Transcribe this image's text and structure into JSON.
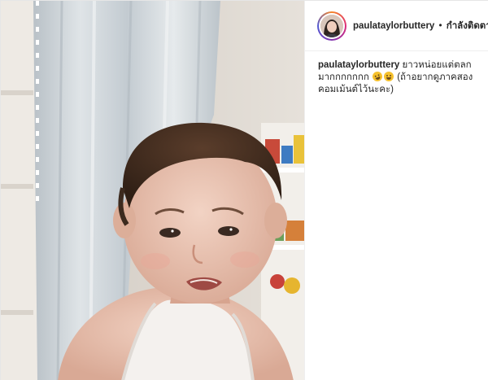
{
  "post": {
    "username": "paulataylorbuttery",
    "separator": "•",
    "follow_label": "กำลังติดตาม",
    "caption": {
      "username": "paulataylorbuttery",
      "text_before_emoji": "ยาวหน่อยแต่ตลกมากกกกกกก",
      "text_after_emoji": "(ถ้าอยากดูภาคสองคอมเม้นต์ไว้นะคะ)",
      "emojis": [
        "rolling-on-floor-laughing-emoji",
        "grinning-sweat-emoji"
      ]
    }
  },
  "colors": {
    "text": "#262626",
    "border": "#efefef",
    "avatar_ring_start": "#f58529",
    "avatar_ring_end": "#515bd4"
  }
}
